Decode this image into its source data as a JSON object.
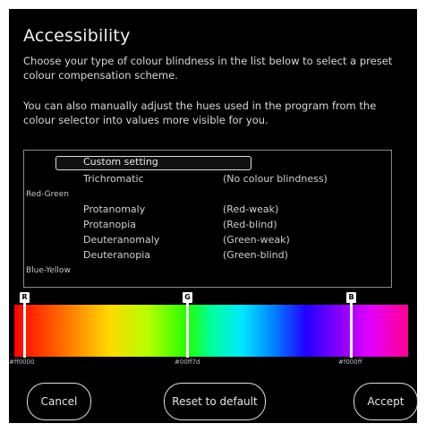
{
  "title": "Accessibility",
  "intro_text": "Choose your type of colour blindness in the list below to select a preset colour compensation scheme.",
  "manual_text": "You can also manually adjust the hues used in the program from the colour selector into values more visible for you.",
  "options": {
    "custom": "Custom setting",
    "trichromatic": {
      "name": "Trichromatic",
      "desc": "(No colour blindness)"
    },
    "group_red_green": "Red-Green",
    "protanomaly": {
      "name": "Protanomaly",
      "desc": "(Red-weak)"
    },
    "protanopia": {
      "name": "Protanopia",
      "desc": "(Red-blind)"
    },
    "deuteranomaly": {
      "name": "Deuteranomaly",
      "desc": "(Green-weak)"
    },
    "deuteranopia": {
      "name": "Deuteranopia",
      "desc": "(Green-blind)"
    },
    "group_blue_yellow": "Blue-Yellow"
  },
  "colour_selector": {
    "markers": [
      {
        "tag": "R",
        "hex": "#ff0000"
      },
      {
        "tag": "G",
        "hex": "#00ff7d"
      },
      {
        "tag": "B",
        "hex": "#f000ff"
      }
    ]
  },
  "buttons": {
    "cancel": "Cancel",
    "reset": "Reset to default",
    "accept": "Accept"
  }
}
